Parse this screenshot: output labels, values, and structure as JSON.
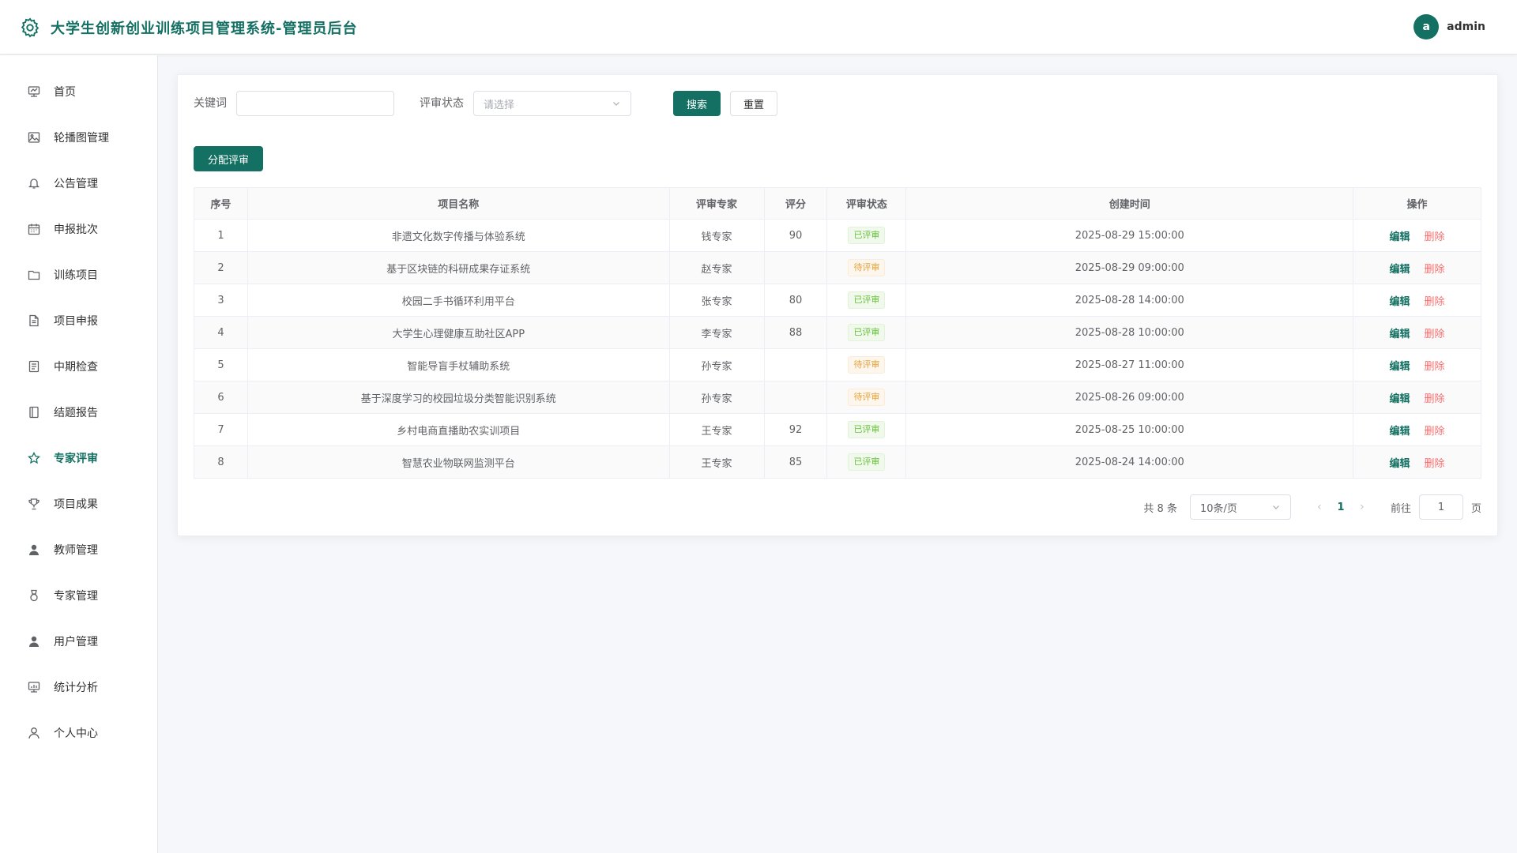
{
  "header": {
    "title": "大学生创新创业训练项目管理系统-管理员后台",
    "avatar_letter": "a",
    "username": "admin"
  },
  "sidebar": {
    "items": [
      {
        "label": "首页",
        "icon": "dashboard-icon"
      },
      {
        "label": "轮播图管理",
        "icon": "image-icon"
      },
      {
        "label": "公告管理",
        "icon": "bell-icon"
      },
      {
        "label": "申报批次",
        "icon": "calendar-icon"
      },
      {
        "label": "训练项目",
        "icon": "folder-icon"
      },
      {
        "label": "项目申报",
        "icon": "document-icon"
      },
      {
        "label": "中期检查",
        "icon": "tickets-icon"
      },
      {
        "label": "结题报告",
        "icon": "notebook-icon"
      },
      {
        "label": "专家评审",
        "icon": "star-icon",
        "active": true
      },
      {
        "label": "项目成果",
        "icon": "trophy-icon"
      },
      {
        "label": "教师管理",
        "icon": "user-filled-icon"
      },
      {
        "label": "专家管理",
        "icon": "medal-icon"
      },
      {
        "label": "用户管理",
        "icon": "user-filled-icon"
      },
      {
        "label": "统计分析",
        "icon": "chart-icon"
      },
      {
        "label": "个人中心",
        "icon": "user-icon"
      }
    ]
  },
  "search": {
    "keyword_label": "关键词",
    "keyword_value": "",
    "status_label": "评审状态",
    "status_placeholder": "请选择",
    "search_button": "搜索",
    "reset_button": "重置"
  },
  "toolbar": {
    "assign_button": "分配评审"
  },
  "table": {
    "columns": [
      "序号",
      "项目名称",
      "评审专家",
      "评分",
      "评审状态",
      "创建时间",
      "操作"
    ],
    "rows": [
      {
        "index": "1",
        "name": "非遗文化数字传播与体验系统",
        "expert": "钱专家",
        "score": "90",
        "status": "已评审",
        "created": "2025-08-29 15:00:00"
      },
      {
        "index": "2",
        "name": "基于区块链的科研成果存证系统",
        "expert": "赵专家",
        "score": "",
        "status": "待评审",
        "created": "2025-08-29 09:00:00"
      },
      {
        "index": "3",
        "name": "校园二手书循环利用平台",
        "expert": "张专家",
        "score": "80",
        "status": "已评审",
        "created": "2025-08-28 14:00:00"
      },
      {
        "index": "4",
        "name": "大学生心理健康互助社区APP",
        "expert": "李专家",
        "score": "88",
        "status": "已评审",
        "created": "2025-08-28 10:00:00"
      },
      {
        "index": "5",
        "name": "智能导盲手杖辅助系统",
        "expert": "孙专家",
        "score": "",
        "status": "待评审",
        "created": "2025-08-27 11:00:00"
      },
      {
        "index": "6",
        "name": "基于深度学习的校园垃圾分类智能识别系统",
        "expert": "孙专家",
        "score": "",
        "status": "待评审",
        "created": "2025-08-26 09:00:00"
      },
      {
        "index": "7",
        "name": "乡村电商直播助农实训项目",
        "expert": "王专家",
        "score": "92",
        "status": "已评审",
        "created": "2025-08-25 10:00:00"
      },
      {
        "index": "8",
        "name": "智慧农业物联网监测平台",
        "expert": "王专家",
        "score": "85",
        "status": "已评审",
        "created": "2025-08-24 14:00:00"
      }
    ],
    "edit_label": "编辑",
    "delete_label": "删除"
  },
  "pagination": {
    "total_text": "共 8 条",
    "page_size": "10条/页",
    "current_page": "1",
    "goto_label": "前往",
    "goto_value": "1",
    "page_suffix": "页"
  },
  "colors": {
    "primary": "#137062",
    "reviewed": "#67c23a",
    "pending": "#e6a23c",
    "danger": "#f56c6c"
  }
}
